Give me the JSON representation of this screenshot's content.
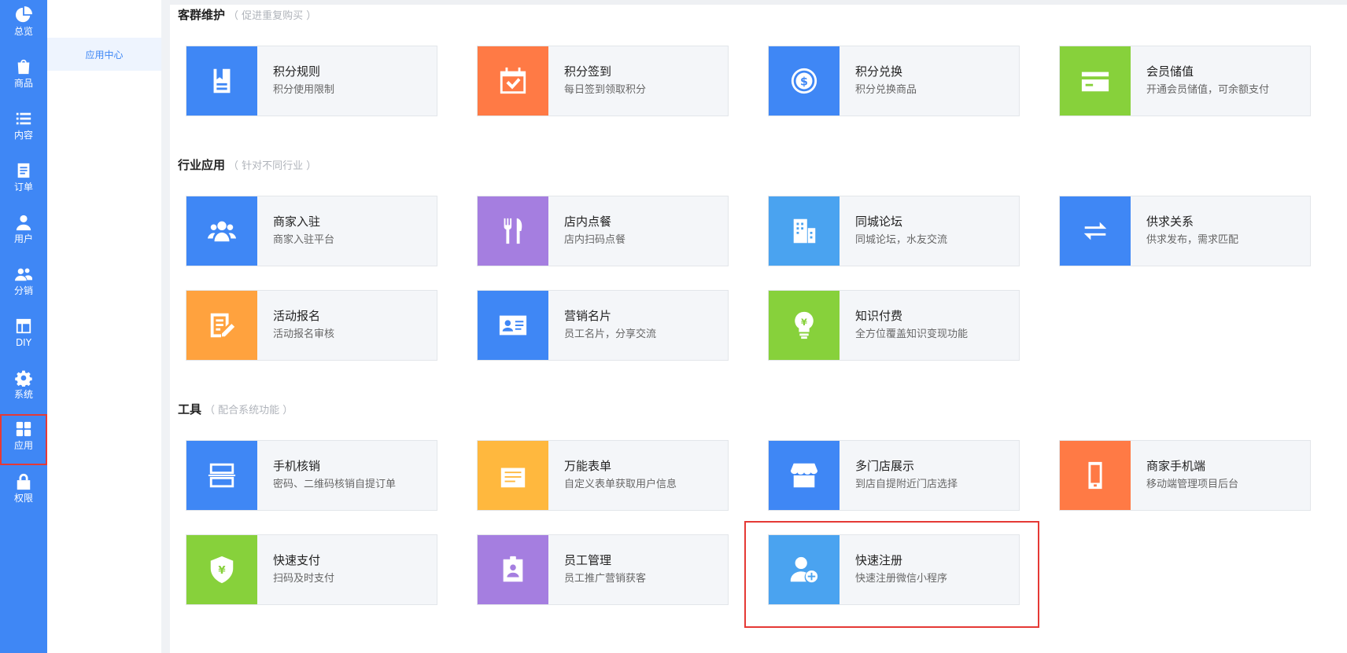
{
  "nav": {
    "items": [
      {
        "label": "总览",
        "icon": "pie-chart-icon"
      },
      {
        "label": "商品",
        "icon": "shopping-bag-icon"
      },
      {
        "label": "内容",
        "icon": "list-icon"
      },
      {
        "label": "订单",
        "icon": "document-icon"
      },
      {
        "label": "用户",
        "icon": "user-icon"
      },
      {
        "label": "分销",
        "icon": "users-icon"
      },
      {
        "label": "DIY",
        "icon": "layout-icon"
      },
      {
        "label": "系统",
        "icon": "gear-icon"
      },
      {
        "label": "应用",
        "icon": "grid-icon",
        "active": true
      },
      {
        "label": "权限",
        "icon": "lock-icon"
      }
    ]
  },
  "submenu": {
    "items": [
      {
        "label": "应用中心"
      }
    ]
  },
  "sections": [
    {
      "title": "客群维护",
      "subtitle": "（ 促进重复购买 ）",
      "cards": [
        {
          "title": "积分规则",
          "desc": "积分使用限制",
          "color": "#3f87f5",
          "icon": "clipboard-icon"
        },
        {
          "title": "积分签到",
          "desc": "每日签到领取积分",
          "color": "#ff7a45",
          "icon": "calendar-check-icon"
        },
        {
          "title": "积分兑换",
          "desc": "积分兑换商品",
          "color": "#3f87f5",
          "icon": "dollar-coin-icon"
        },
        {
          "title": "会员储值",
          "desc": "开通会员储值，可余额支付",
          "color": "#87d13b",
          "icon": "card-icon"
        }
      ]
    },
    {
      "title": "行业应用",
      "subtitle": "（ 针对不同行业 ）",
      "cards": [
        {
          "title": "商家入驻",
          "desc": "商家入驻平台",
          "color": "#3f87f5",
          "icon": "merchant-icon"
        },
        {
          "title": "店内点餐",
          "desc": "店内扫码点餐",
          "color": "#a57ee0",
          "icon": "fork-knife-icon"
        },
        {
          "title": "同城论坛",
          "desc": "同城论坛，水友交流",
          "color": "#4aa3f0",
          "icon": "building-icon"
        },
        {
          "title": "供求关系",
          "desc": "供求发布，需求匹配",
          "color": "#3f87f5",
          "icon": "swap-icon"
        },
        {
          "title": "活动报名",
          "desc": "活动报名审核",
          "color": "#ffa23e",
          "icon": "edit-note-icon"
        },
        {
          "title": "营销名片",
          "desc": "员工名片，分享交流",
          "color": "#3f87f5",
          "icon": "id-card-icon"
        },
        {
          "title": "知识付费",
          "desc": "全方位覆盖知识变现功能",
          "color": "#87d13b",
          "icon": "bulb-yen-icon"
        }
      ]
    },
    {
      "title": "工具",
      "subtitle": "（ 配合系统功能 ）",
      "cards": [
        {
          "title": "手机核销",
          "desc": "密码、二维码核销自提订单",
          "color": "#3f87f5",
          "icon": "scan-icon"
        },
        {
          "title": "万能表单",
          "desc": "自定义表单获取用户信息",
          "color": "#ffb83e",
          "icon": "form-icon"
        },
        {
          "title": "多门店展示",
          "desc": "到店自提附近门店选择",
          "color": "#3f87f5",
          "icon": "store-icon"
        },
        {
          "title": "商家手机端",
          "desc": "移动端管理项目后台",
          "color": "#ff7a45",
          "icon": "phone-icon"
        },
        {
          "title": "快速支付",
          "desc": "扫码及时支付",
          "color": "#87d13b",
          "icon": "shield-yen-icon"
        },
        {
          "title": "员工管理",
          "desc": "员工推广营销获客",
          "color": "#a57ee0",
          "icon": "badge-icon"
        },
        {
          "title": "快速注册",
          "desc": "快速注册微信小程序",
          "color": "#4aa3f0",
          "icon": "user-add-icon"
        }
      ]
    }
  ]
}
